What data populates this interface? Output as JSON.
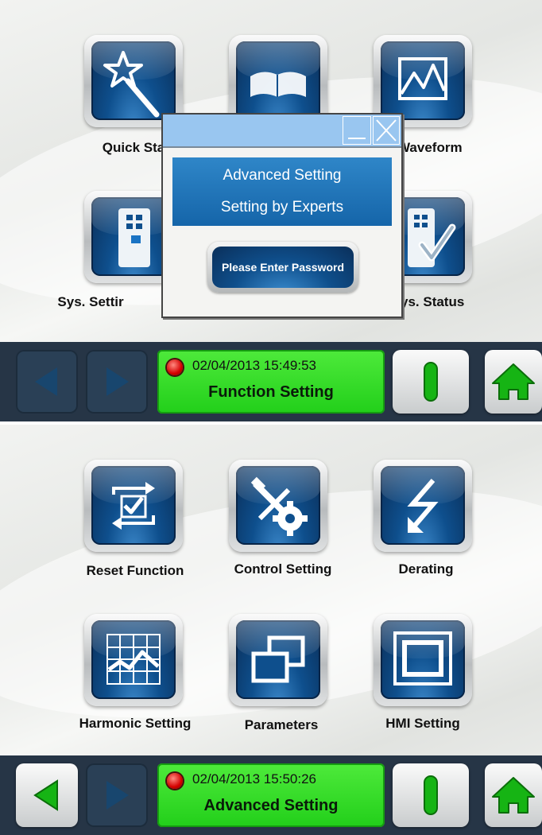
{
  "screen1": {
    "icons": [
      {
        "label": "Quick Sta",
        "icon": "wand-star-icon"
      },
      {
        "label": "",
        "icon": "open-book-icon"
      },
      {
        "label": "Waveform",
        "icon": "waveform-icon"
      },
      {
        "label": "Sys. Settir",
        "icon": "cabinet-icon"
      },
      {
        "label": "",
        "icon": "hidden"
      },
      {
        "label": "ys. Status",
        "icon": "cabinet-check-icon"
      }
    ],
    "dialog": {
      "line1": "Advanced Setting",
      "line2": "Setting by Experts",
      "password_button": "Please Enter Password"
    },
    "status_bar": {
      "datetime": "02/04/2013  15:49:53",
      "function": "Function Setting"
    }
  },
  "screen2": {
    "icons": [
      {
        "label": "Reset Function",
        "icon": "reset-cycle-icon"
      },
      {
        "label": "Control Setting",
        "icon": "tools-gear-icon"
      },
      {
        "label": "Derating",
        "icon": "lightning-arrow-icon"
      },
      {
        "label": "Harmonic Setting",
        "icon": "harmonic-chart-icon"
      },
      {
        "label": "Parameters",
        "icon": "windows-stack-icon"
      },
      {
        "label": "HMI Setting",
        "icon": "monitor-frame-icon"
      }
    ],
    "status_bar": {
      "datetime": "02/04/2013  15:50:26",
      "function": "Advanced Setting"
    }
  },
  "colors": {
    "status_green": "#2bd621",
    "bar_background": "#263546",
    "icon_blue": "#0e4f8d",
    "dialog_title": "#99c6f0"
  }
}
